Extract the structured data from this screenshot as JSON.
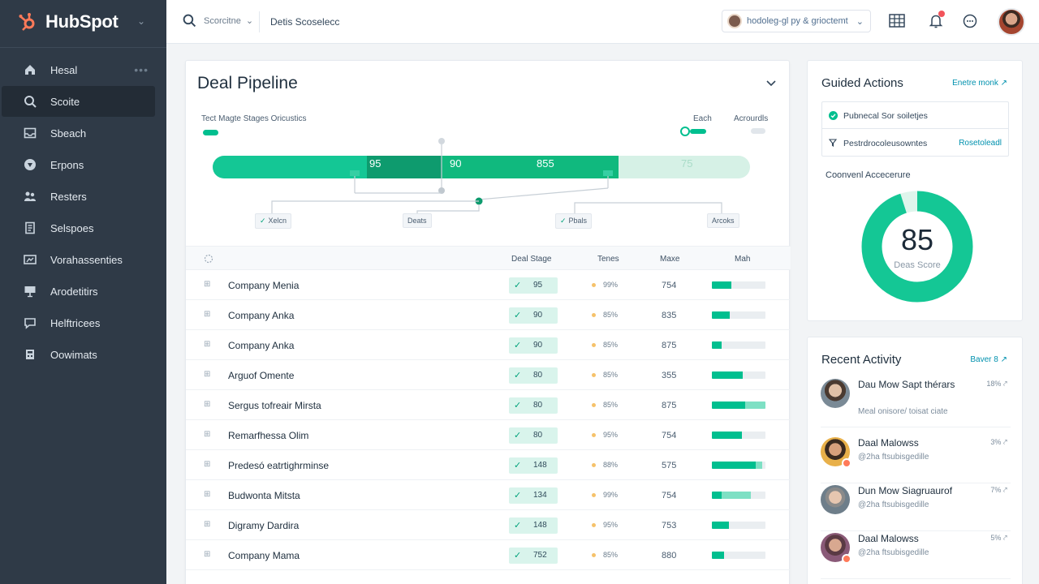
{
  "brand": {
    "name": "HubSpot"
  },
  "sidebar": {
    "items": [
      {
        "label": "Hesal",
        "icon": "home-icon",
        "active": false
      },
      {
        "label": "Scoite",
        "icon": "search-icon",
        "active": true
      },
      {
        "label": "Sbeach",
        "icon": "inbox-icon",
        "active": false
      },
      {
        "label": "Erpons",
        "icon": "shield-icon",
        "active": false
      },
      {
        "label": "Resters",
        "icon": "people-icon",
        "active": false
      },
      {
        "label": "Selspoes",
        "icon": "document-icon",
        "active": false
      },
      {
        "label": "Vorahassenties",
        "icon": "video-icon",
        "active": false
      },
      {
        "label": "Arodetitirs",
        "icon": "presentation-icon",
        "active": false
      },
      {
        "label": "Helftricees",
        "icon": "chat-icon",
        "active": false
      },
      {
        "label": "Oowimats",
        "icon": "calculator-icon",
        "active": false
      }
    ]
  },
  "topbar": {
    "scope_label": "Scorcitne",
    "search_value": "Detis Scoselecc",
    "account_label": "hodoleg-gl py & grioctemt"
  },
  "pipeline": {
    "title": "Deal Pipeline",
    "left_label": "Tect Magte Stages Oricustics",
    "right_label_1": "Each",
    "right_label_2": "Acrourdls",
    "stages": [
      "95",
      "90",
      "855",
      "75"
    ],
    "nodes": [
      "Xelcn",
      "Deats",
      "Pbals",
      "Arcoks"
    ]
  },
  "table": {
    "headers": {
      "stage": "Deal Stage",
      "tenes": "Tenes",
      "maxe": "Maxe",
      "mah": "Mah"
    },
    "rows": [
      {
        "name": "Company Menia",
        "stage": "95",
        "tenes": "99%",
        "maxe": "754",
        "bar": 0.37,
        "bar2": 0
      },
      {
        "name": "Company Anka",
        "stage": "90",
        "tenes": "85%",
        "maxe": "835",
        "bar": 0.33,
        "bar2": 0
      },
      {
        "name": "Company Anka",
        "stage": "90",
        "tenes": "85%",
        "maxe": "875",
        "bar": 0.18,
        "bar2": 0
      },
      {
        "name": "Arguof Omente",
        "stage": "80",
        "tenes": "85%",
        "maxe": "355",
        "bar": 0.58,
        "bar2": 0
      },
      {
        "name": "Sergus tofreair Mirsta",
        "stage": "80",
        "tenes": "85%",
        "maxe": "875",
        "bar": 0.62,
        "bar2": 0.38
      },
      {
        "name": "Remarfhessa Olim",
        "stage": "80",
        "tenes": "95%",
        "maxe": "754",
        "bar": 0.56,
        "bar2": 0
      },
      {
        "name": "Predesó eatrtighrminse",
        "stage": "148",
        "tenes": "88%",
        "maxe": "575",
        "bar": 0.82,
        "bar2": 0.12
      },
      {
        "name": "Budwonta Mitsta",
        "stage": "134",
        "tenes": "99%",
        "maxe": "754",
        "bar": 0.18,
        "bar2": 0.55
      },
      {
        "name": "Digramy Dardira",
        "stage": "148",
        "tenes": "95%",
        "maxe": "753",
        "bar": 0.32,
        "bar2": 0
      },
      {
        "name": "Company Mama",
        "stage": "752",
        "tenes": "85%",
        "maxe": "880",
        "bar": 0.23,
        "bar2": 0
      }
    ]
  },
  "guided": {
    "title": "Guided Actions",
    "link": "Enetre monk",
    "items": [
      {
        "label": "Pubnecal Sor soiletjes",
        "link": ""
      },
      {
        "label": "Pestrdrocoleusowntes",
        "link": "Rosetoleadl"
      }
    ],
    "conversion_label": "Coonvenl Accecerure",
    "score_value": 85,
    "score_label": "Deas Score",
    "score_fraction": 0.95
  },
  "activity": {
    "title": "Recent Activity",
    "link": "Baver 8",
    "items": [
      {
        "name": "Dau Mow Sapt thérars",
        "sub": "Meal onisore/ toisat ciate",
        "pct": "18%"
      },
      {
        "name": "Daal Malowss",
        "sub": "@2ha ftsubisgedille",
        "pct": "3%"
      },
      {
        "name": "Dun Mow Siagruaurof",
        "sub": "@2ha ftsubisgedille",
        "pct": "7%"
      },
      {
        "name": "Daal Malowss",
        "sub": "@2ha ftsubisgedille",
        "pct": "5%"
      }
    ]
  },
  "colors": {
    "accent": "#00bf8f",
    "sidebar": "#2f3a47",
    "brand_orange": "#ff7a59"
  }
}
